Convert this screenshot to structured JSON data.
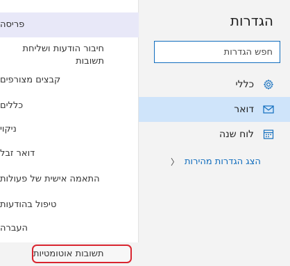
{
  "settings": {
    "title": "הגדרות",
    "search_placeholder": "חפש הגדרות",
    "nav": [
      {
        "label": "כללי",
        "icon": "gear-icon"
      },
      {
        "label": "דואר",
        "icon": "mail-icon"
      },
      {
        "label": "לוח שנה",
        "icon": "calendar-icon"
      }
    ],
    "quick_settings_label": "הצג הגדרות מהירות"
  },
  "mail_settings": {
    "items": [
      {
        "label": "פריסה"
      },
      {
        "label": "חיבור הודעות ושליחת תשובות"
      },
      {
        "label": "קבצים מצורפים"
      },
      {
        "label": "כללים"
      },
      {
        "label": "ניקוי"
      },
      {
        "label": "דואר זבל"
      },
      {
        "label": "התאמה אישית של פעולות"
      },
      {
        "label": "טיפול בהודעות"
      },
      {
        "label": "העברה"
      }
    ],
    "auto_replies_label": "תשובות אוטומטיות"
  },
  "colors": {
    "accent": "#0f6cbd",
    "selected_nav_bg": "#cfe4fa",
    "selected_item_bg": "#e8e8f8",
    "highlight_border": "#d9252f"
  }
}
